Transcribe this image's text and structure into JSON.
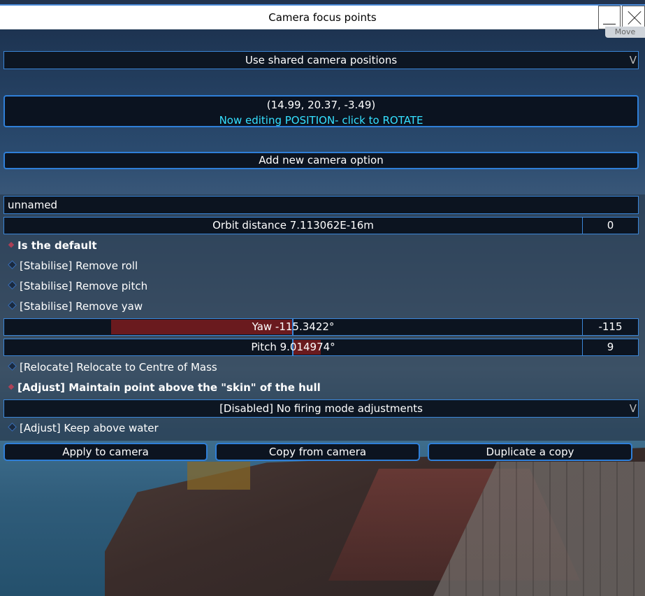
{
  "window": {
    "title": "Camera focus points",
    "move_label": "Move"
  },
  "shared_dropdown": {
    "value": "Use shared camera positions",
    "arrow": "V"
  },
  "position_button": {
    "coords": "(14.99, 20.37, -3.49)",
    "mode": "Now editing POSITION- click to ROTATE"
  },
  "add_button": "Add new camera option",
  "name_field": {
    "value": "unnamed"
  },
  "orbit": {
    "label": "Orbit distance 7.113062E-16m",
    "value": "0"
  },
  "options": [
    {
      "label": "Is the default",
      "checked": true
    },
    {
      "label": "[Stabilise] Remove roll",
      "checked": false
    },
    {
      "label": "[Stabilise] Remove pitch",
      "checked": false
    },
    {
      "label": "[Stabilise] Remove yaw",
      "checked": false
    }
  ],
  "yaw": {
    "label": "Yaw -115.3422°",
    "value": "-115",
    "fraction": 0.18
  },
  "pitch": {
    "label": "Pitch 9.014974°",
    "value": "9",
    "fraction": 0.05
  },
  "options2": [
    {
      "label": "[Relocate] Relocate to Centre of Mass",
      "checked": false
    },
    {
      "label": "[Adjust] Maintain point above the \"skin\" of the hull",
      "checked": true
    }
  ],
  "firing_dropdown": {
    "value": "[Disabled] No firing mode adjustments",
    "arrow": "V"
  },
  "option_water": {
    "label": "[Adjust] Keep above water",
    "checked": false
  },
  "buttons": {
    "apply": "Apply to camera",
    "copy": "Copy from camera",
    "duplicate": "Duplicate a copy"
  }
}
